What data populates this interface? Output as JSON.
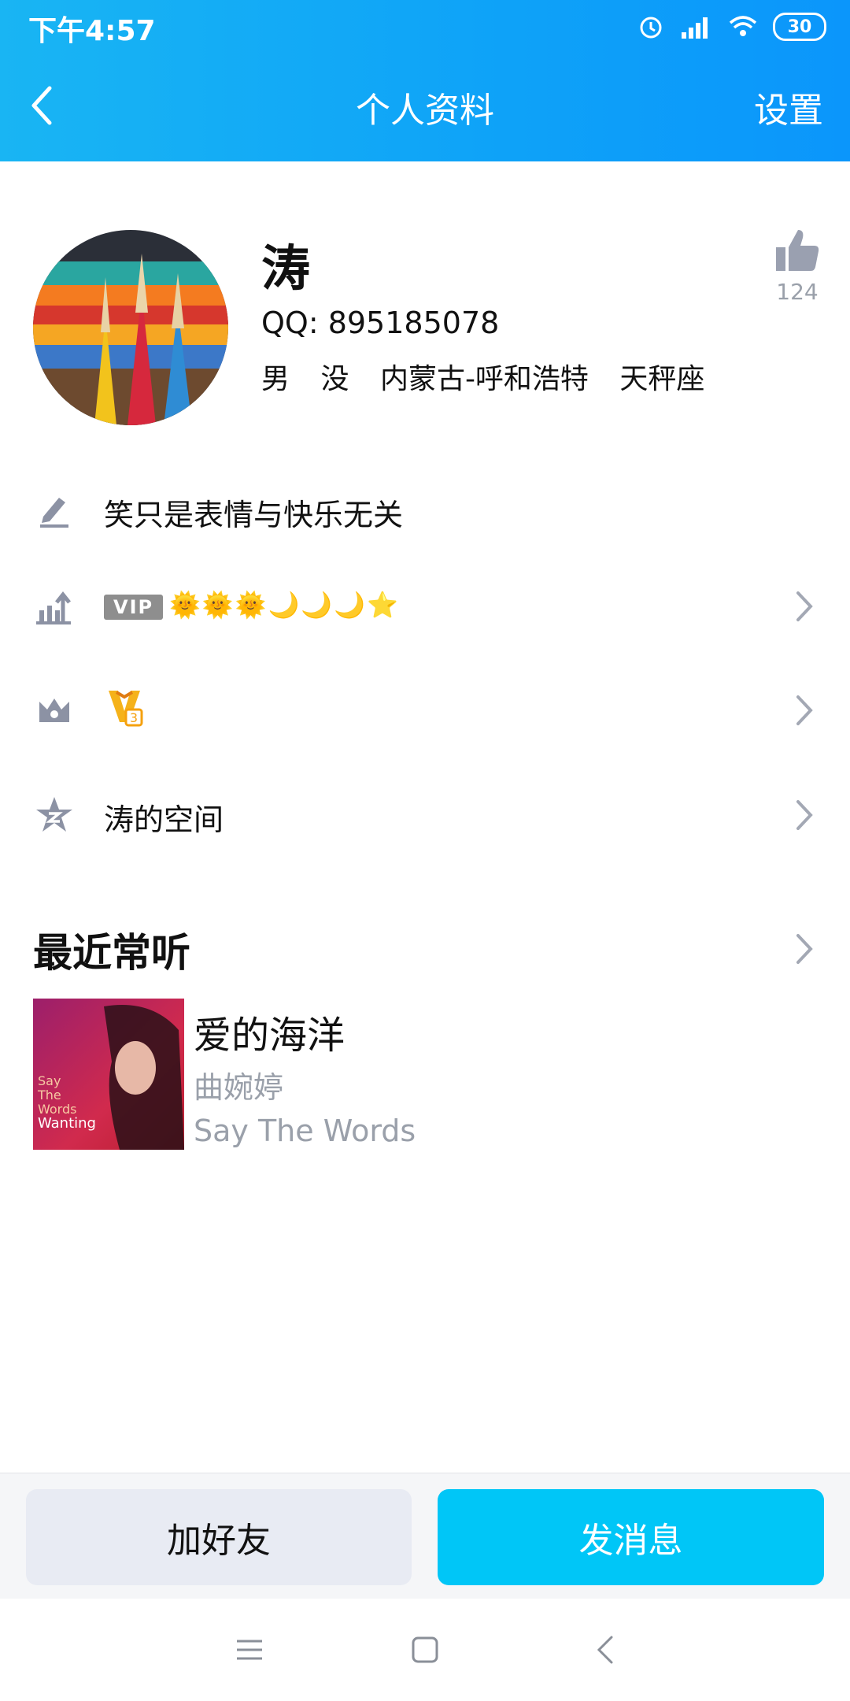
{
  "status": {
    "time": "下午4:57",
    "battery": "30"
  },
  "header": {
    "title": "个人资料",
    "settings": "设置"
  },
  "profile": {
    "name": "涛",
    "qq": "QQ: 895185078",
    "info": [
      "男",
      "没",
      "内蒙古-呼和浩特",
      "天秤座"
    ],
    "likes": "124"
  },
  "rows": {
    "signature": "笑只是表情与快乐无关",
    "vip_badge": "VIP",
    "levels": "🌞🌞🌞🌙🌙🌙⭐",
    "space": "涛的空间"
  },
  "recent": {
    "title": "最近常听",
    "song": {
      "title": "爱的海洋",
      "artist": "曲婉婷",
      "album": "Say The Words"
    }
  },
  "actions": {
    "add_friend": "加好友",
    "send_message": "发消息"
  }
}
